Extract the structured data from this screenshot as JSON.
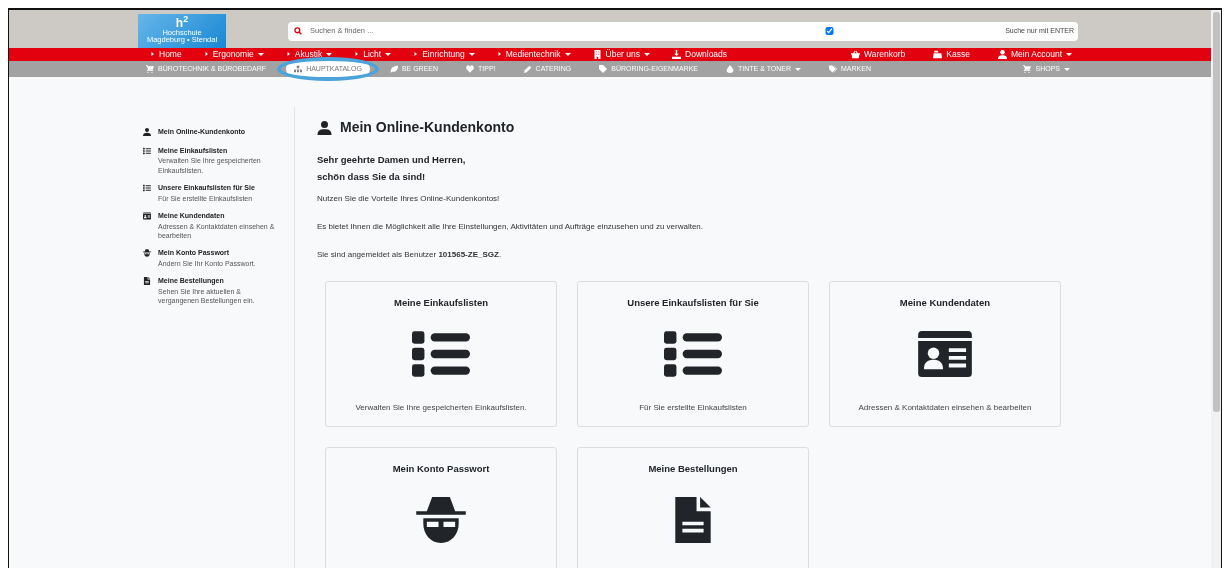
{
  "logo": {
    "mark": "h",
    "sup": "2",
    "lines": [
      "Hochschule",
      "Magdeburg • Stendal"
    ]
  },
  "search": {
    "placeholder": "Suchen & finden ...",
    "enter_only": {
      "label": "Suche nur mit ENTER",
      "checked": true
    }
  },
  "main_nav": [
    {
      "label": "Home",
      "dropdown": false
    },
    {
      "label": "Ergonomie",
      "dropdown": true
    },
    {
      "label": "Akustik",
      "dropdown": true
    },
    {
      "label": "Licht",
      "dropdown": true
    },
    {
      "label": "Einrichtung",
      "dropdown": true
    },
    {
      "label": "Medientechnik",
      "dropdown": true
    },
    {
      "label": "Über uns",
      "dropdown": true
    },
    {
      "label": "Downloads",
      "dropdown": false
    }
  ],
  "main_nav_right": [
    {
      "label": "Warenkorb",
      "dropdown": false
    },
    {
      "label": "Kasse",
      "dropdown": false
    },
    {
      "label": "Mein Account",
      "dropdown": true
    }
  ],
  "sub_nav": [
    {
      "label": "BÜROTECHNIK & BÜROBEDARF",
      "dropdown": false,
      "selected": false,
      "highlighted": false
    },
    {
      "label": "HAUPTKATALOG",
      "dropdown": false,
      "selected": true,
      "highlighted": true
    },
    {
      "label": "BE GREEN",
      "dropdown": false,
      "selected": false,
      "highlighted": false
    },
    {
      "label": "TIPP!",
      "dropdown": false,
      "selected": false,
      "highlighted": false
    },
    {
      "label": "CATERING",
      "dropdown": false,
      "selected": false,
      "highlighted": false
    },
    {
      "label": "BÜRORING-EIGENMARKE",
      "dropdown": false,
      "selected": false,
      "highlighted": false
    },
    {
      "label": "TINTE & TONER",
      "dropdown": true,
      "selected": false,
      "highlighted": false
    },
    {
      "label": "MARKEN",
      "dropdown": false,
      "selected": false,
      "highlighted": false
    }
  ],
  "sub_nav_right": [
    {
      "label": "SHOPS",
      "dropdown": true,
      "selected": false,
      "highlighted": false
    }
  ],
  "sidebar": [
    {
      "title": "Mein Online-Kundenkonto"
    },
    {
      "title": "Meine Einkaufslisten",
      "text": "Verwalten Sie Ihre gespeicherten Einkaufslisten."
    },
    {
      "title": "Unsere Einkaufslisten für Sie",
      "text": "Für Sie erstellte Einkaufslisten"
    },
    {
      "title": "Meine Kundendaten",
      "text": "Adressen & Kontaktdaten einsehen & bearbeiten"
    },
    {
      "title": "Mein Konto Passwort",
      "text": "Ändern Sie Ihr Konto Passwort."
    },
    {
      "title": "Meine Bestellungen",
      "text": "Sehen Sie Ihre aktuellen & vergangenen Bestellungen ein."
    }
  ],
  "heading": "Mein Online-Kundenkonto",
  "greeting": [
    "Sehr geehrte Damen und Herren,",
    "schön dass Sie da sind!"
  ],
  "paragraphs": [
    "Nutzen Sie die Vorteile Ihres Online-Kundenkontos!",
    "Es bietet Ihnen die Möglichkeit alle Ihre Einstellungen, Aktivitäten und Aufträge einzusehen und zu verwalten.",
    "Sie sind angemeldet als Benutzer **101565-ZE_SGZ**."
  ],
  "cards": [
    {
      "title": "Meine Einkaufslisten",
      "text": "Verwalten Sie Ihre gespeicherten Einkaufslisten."
    },
    {
      "title": "Unsere Einkaufslisten für Sie",
      "text": "Für Sie erstellte Einkaufslisten"
    },
    {
      "title": "Meine Kundendaten",
      "text": "Adressen & Kontaktdaten einsehen & bearbeiten"
    },
    {
      "title": "Mein Konto Passwort"
    },
    {
      "title": "Meine Bestellungen"
    }
  ]
}
